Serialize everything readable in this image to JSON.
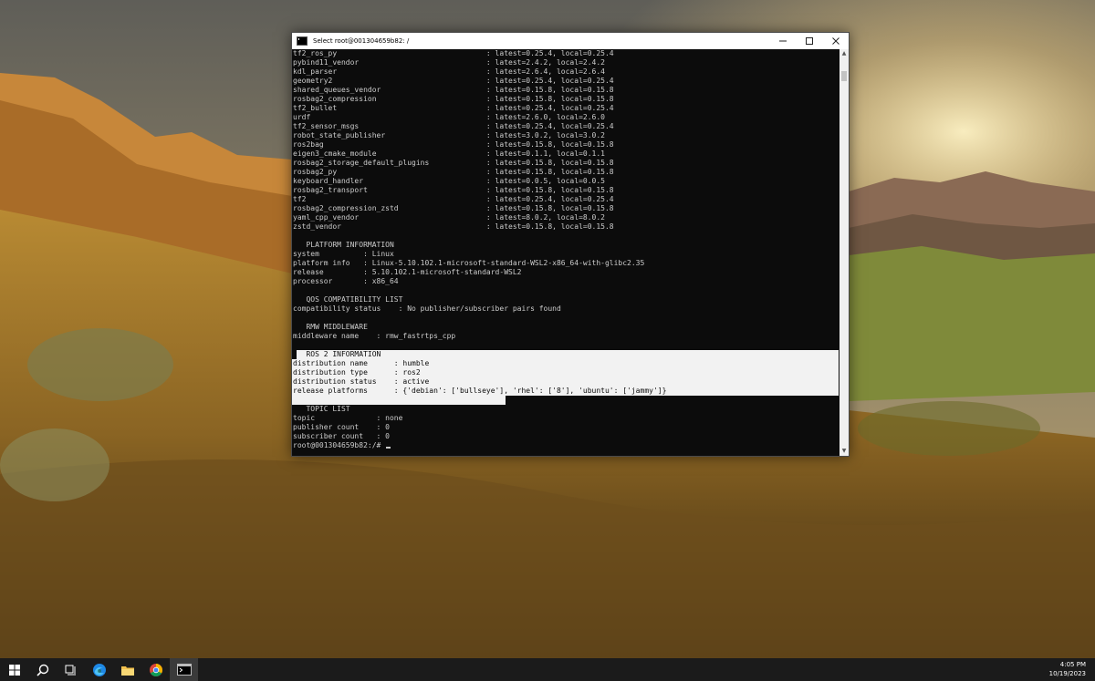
{
  "window": {
    "title": "Select root@001304659b82: /",
    "controls": {
      "minimize_icon": "minimize-icon",
      "maximize_icon": "maximize-icon",
      "close_icon": "close-icon"
    }
  },
  "terminal": {
    "lines": [
      "tf2_ros_py                                  : latest=0.25.4, local=0.25.4",
      "pybind11_vendor                             : latest=2.4.2, local=2.4.2",
      "kdl_parser                                  : latest=2.6.4, local=2.6.4",
      "geometry2                                   : latest=0.25.4, local=0.25.4",
      "shared_queues_vendor                        : latest=0.15.8, local=0.15.8",
      "rosbag2_compression                         : latest=0.15.8, local=0.15.8",
      "tf2_bullet                                  : latest=0.25.4, local=0.25.4",
      "urdf                                        : latest=2.6.0, local=2.6.0",
      "tf2_sensor_msgs                             : latest=0.25.4, local=0.25.4",
      "robot_state_publisher                       : latest=3.0.2, local=3.0.2",
      "ros2bag                                     : latest=0.15.8, local=0.15.8",
      "eigen3_cmake_module                         : latest=0.1.1, local=0.1.1",
      "rosbag2_storage_default_plugins             : latest=0.15.8, local=0.15.8",
      "rosbag2_py                                  : latest=0.15.8, local=0.15.8",
      "keyboard_handler                            : latest=0.0.5, local=0.0.5",
      "rosbag2_transport                           : latest=0.15.8, local=0.15.8",
      "tf2                                         : latest=0.25.4, local=0.25.4",
      "rosbag2_compression_zstd                    : latest=0.15.8, local=0.15.8",
      "yaml_cpp_vendor                             : latest=8.0.2, local=8.0.2",
      "zstd_vendor                                 : latest=0.15.8, local=0.15.8",
      "",
      "   PLATFORM INFORMATION",
      "system          : Linux",
      "platform info   : Linux-5.10.102.1-microsoft-standard-WSL2-x86_64-with-glibc2.35",
      "release         : 5.10.102.1-microsoft-standard-WSL2",
      "processor       : x86_64",
      "",
      "   QOS COMPATIBILITY LIST",
      "compatibility status    : No publisher/subscriber pairs found",
      "",
      "   RMW MIDDLEWARE",
      "middleware name    : rmw_fastrtps_cpp",
      "",
      "   ROS 2 INFORMATION",
      "distribution name      : humble",
      "distribution type      : ros2",
      "distribution status    : active",
      "release platforms      : {'debian': ['bullseye'], 'rhel': ['8'], 'ubuntu': ['jammy']}",
      "",
      "   TOPIC LIST",
      "topic              : none",
      "publisher count    : 0",
      "subscriber count   : 0"
    ],
    "prompt": "root@001304659b82:/#"
  },
  "taskbar": {
    "items": [
      {
        "icon": "windows-start-icon",
        "active": false
      },
      {
        "icon": "search-icon",
        "active": false
      },
      {
        "icon": "task-view-icon",
        "active": false
      },
      {
        "icon": "edge-browser-icon",
        "active": false
      },
      {
        "icon": "file-explorer-icon",
        "active": false
      },
      {
        "icon": "chrome-icon",
        "active": false
      },
      {
        "icon": "terminal-icon",
        "active": true
      }
    ],
    "time": "4:05 PM",
    "date": "10/19/2023"
  }
}
